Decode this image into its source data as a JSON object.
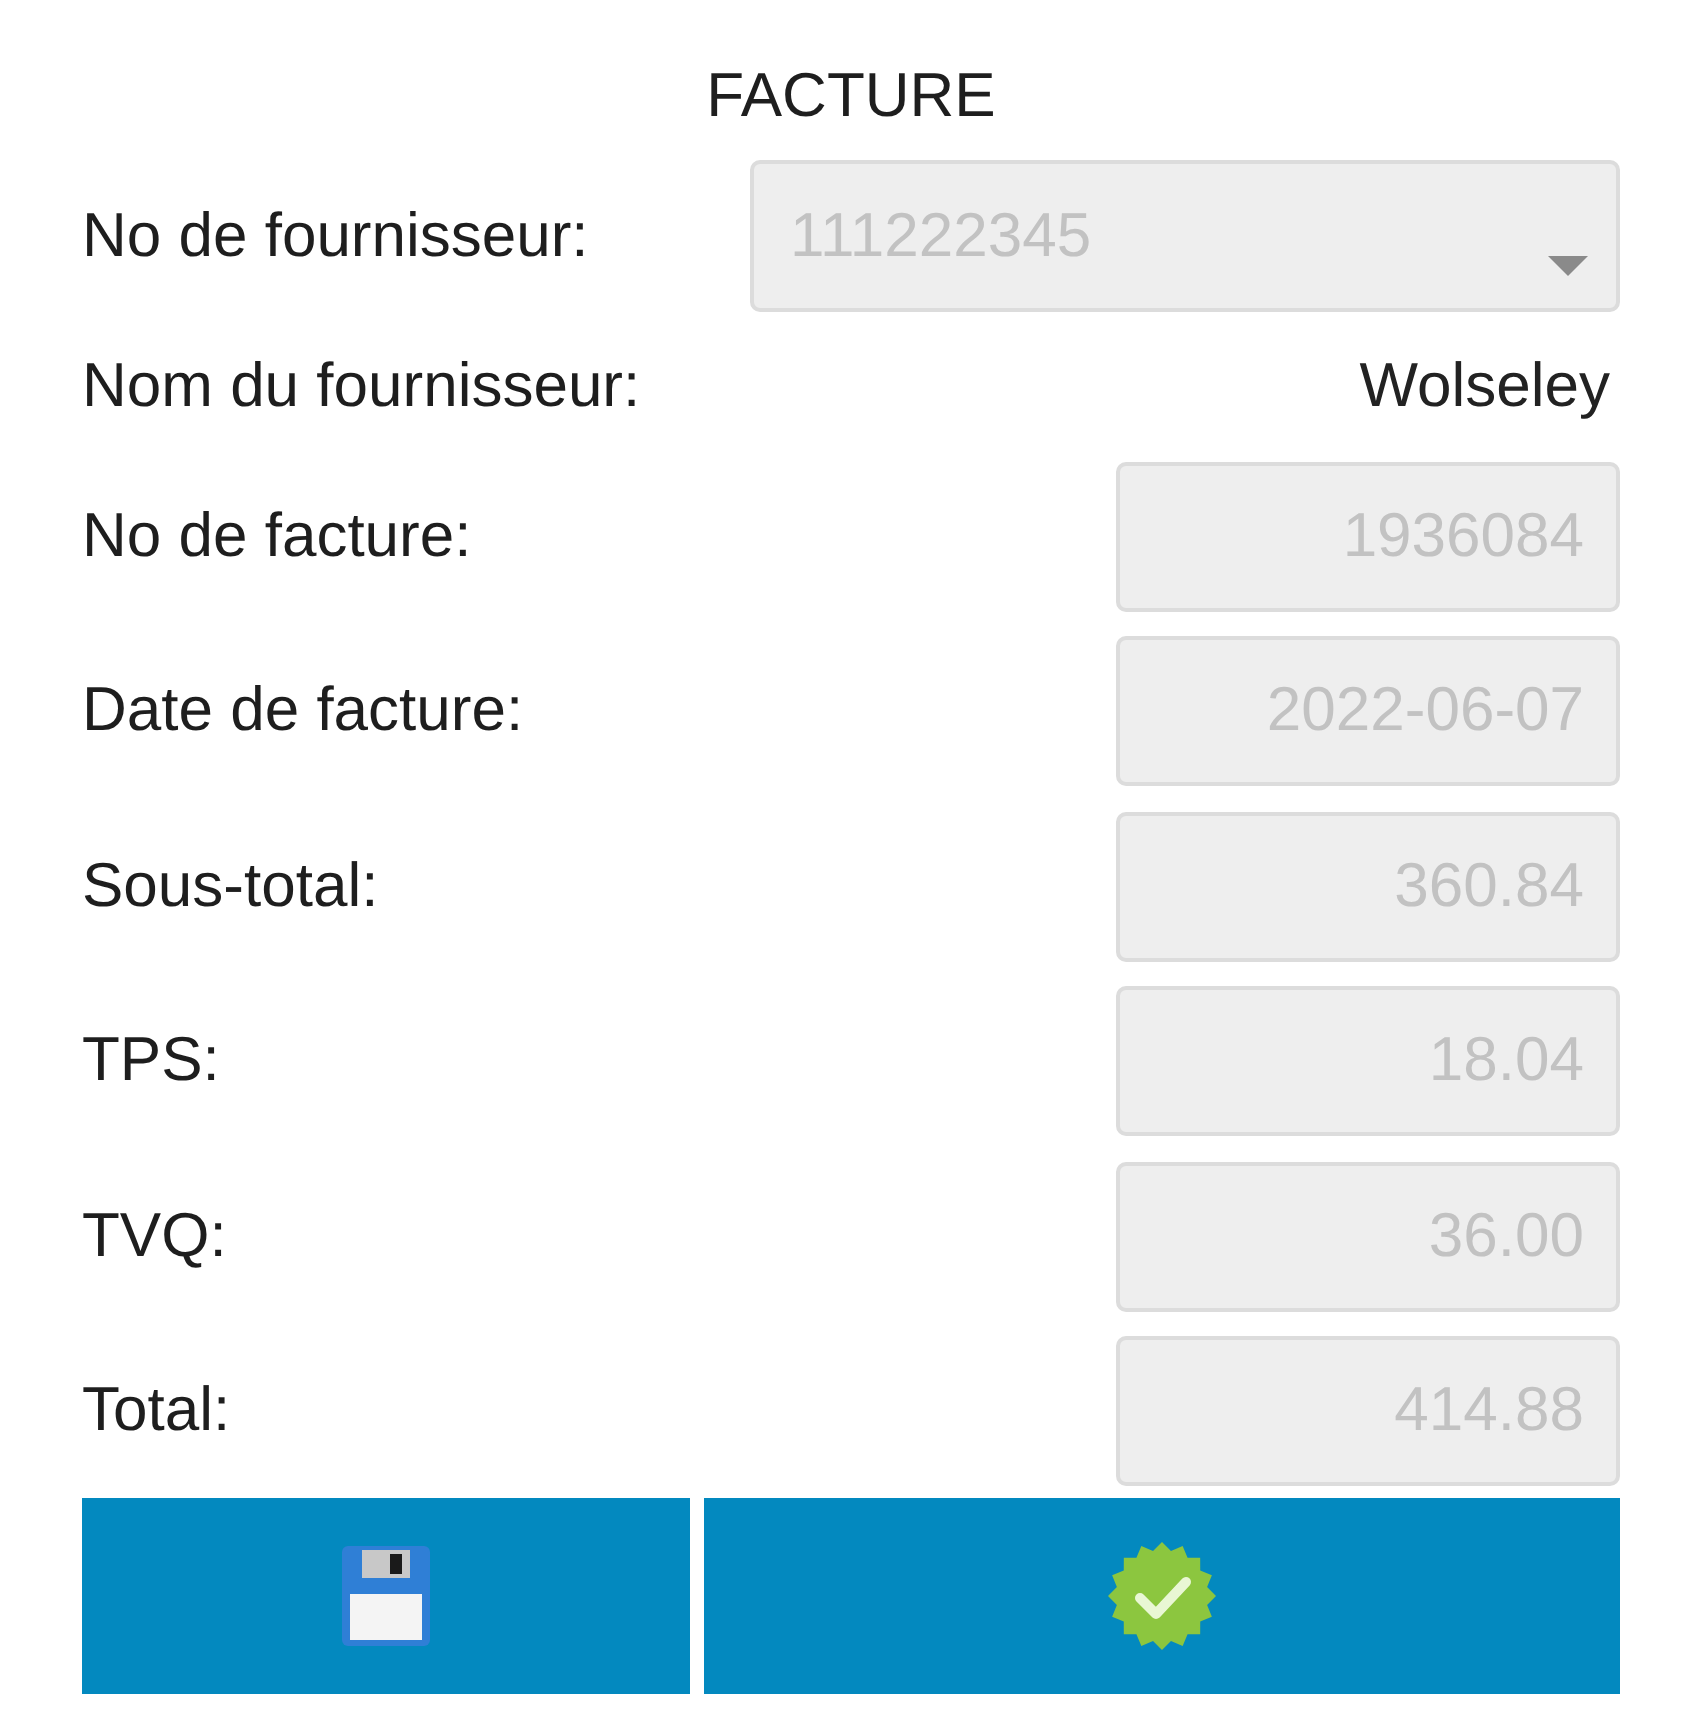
{
  "title": "FACTURE",
  "fields": [
    {
      "kind": "dropdown",
      "label": "No de fournisseur:",
      "value": "111222345",
      "disabled": true
    },
    {
      "kind": "text",
      "label": "Nom du fournisseur:",
      "value": "Wolseley"
    },
    {
      "kind": "input",
      "label": "No de facture:",
      "value": "1936084",
      "disabled": true
    },
    {
      "kind": "input",
      "label": "Date de facture:",
      "value": "2022-06-07",
      "disabled": true
    },
    {
      "kind": "input",
      "label": "Sous-total:",
      "value": "360.84",
      "disabled": true
    },
    {
      "kind": "input",
      "label": "TPS:",
      "value": "18.04",
      "disabled": true
    },
    {
      "kind": "input",
      "label": "TVQ:",
      "value": "36.00",
      "disabled": true
    },
    {
      "kind": "input",
      "label": "Total:",
      "value": "414.88",
      "disabled": true
    }
  ],
  "buttons": [
    {
      "kind": "save"
    },
    {
      "kind": "confirm"
    }
  ]
}
